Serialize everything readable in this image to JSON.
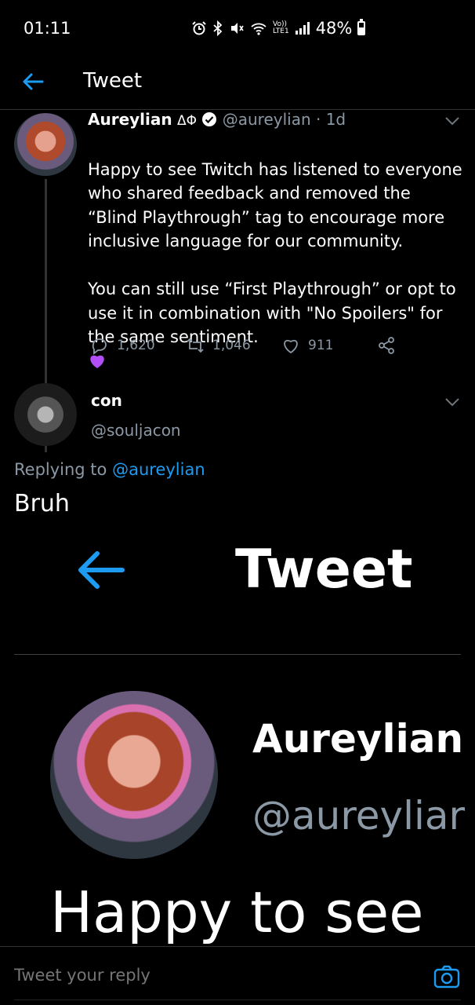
{
  "status_bar": {
    "time": "01:11",
    "network_top": "Vo))",
    "network_bottom": "LTE1",
    "battery": "48%"
  },
  "header": {
    "title": "Tweet"
  },
  "original_tweet": {
    "name": "Aureylian",
    "name_suffix": "ΔΦ",
    "handle_time": "@aureylian · 1d",
    "body": "Happy to see Twitch has listened to everyone who shared feedback and removed the “Blind Playthrough” tag to encourage more inclusive language for our community.\n\nYou can still use “First Playthrough” or opt to use it in combination with \"No Spoilers\" for the same sentiment.",
    "stats": {
      "replies": "1,620",
      "retweets": "1,046",
      "likes": "911"
    }
  },
  "reply_tweet": {
    "name": "con",
    "handle": "@souljacon",
    "replying_prefix": "Replying to",
    "replying_handle": "@aureylian",
    "body": "Bruh"
  },
  "zoomed_screenshot": {
    "title": "Tweet",
    "name": "Aureylian",
    "handle": "@aureyliar",
    "body_start": "Happy to see"
  },
  "reply_bar": {
    "placeholder": "Tweet your reply"
  },
  "colors": {
    "background": "#000000",
    "accent": "#1d9bf0",
    "secondary_text": "#8b98a5",
    "emoji_heart": "#a855f7"
  }
}
